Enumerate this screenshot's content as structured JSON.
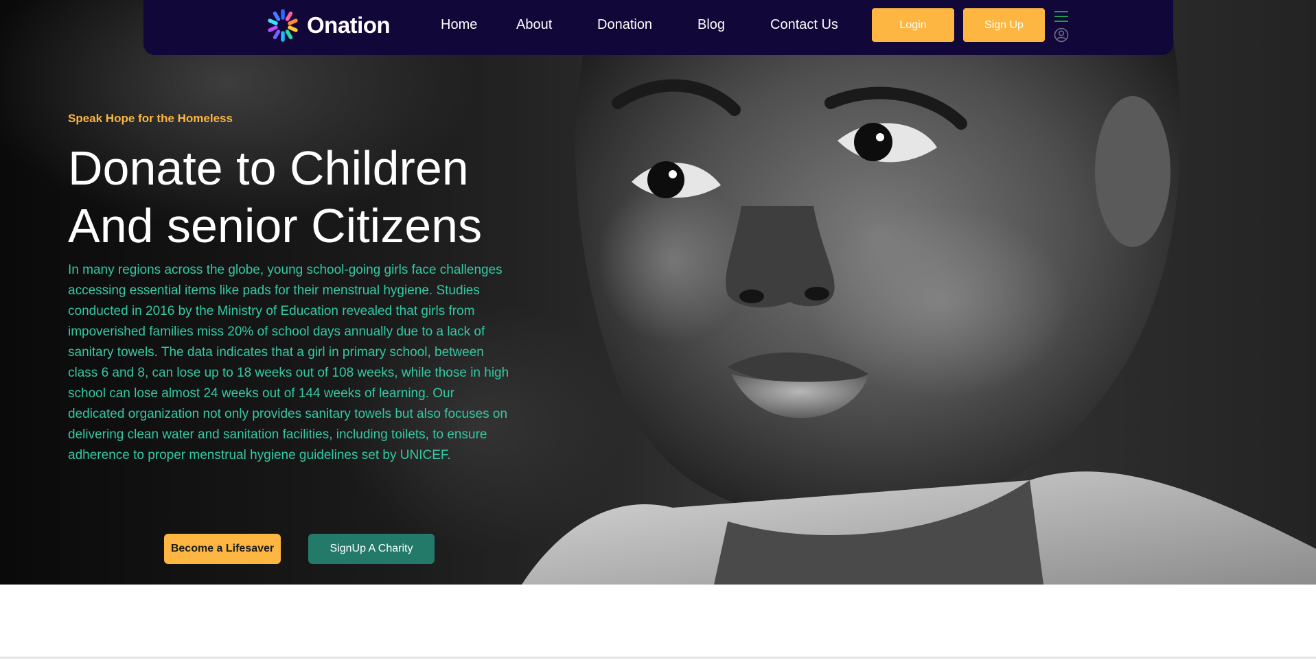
{
  "brand": {
    "name": "Onation"
  },
  "nav": {
    "links": [
      "Home",
      "About",
      "Donation",
      "Blog",
      "Contact Us"
    ],
    "login_label": "Login",
    "signup_label": "Sign Up"
  },
  "hero": {
    "eyebrow": "Speak Hope for the Homeless",
    "headline": [
      "Donate to Children",
      "And senior Citizens"
    ],
    "body": "In many regions across the globe, young school-going girls face challenges accessing essential items like pads for their menstrual hygiene. Studies conducted in 2016 by the Ministry of Education revealed that girls from impoverished families miss 20% of school days annually due to a lack of sanitary towels. The data indicates that a girl in primary school, between class 6 and 8, can lose up to 18 weeks out of 108 weeks, while those in high school can lose almost 24 weeks out of 144 weeks of learning. Our dedicated organization not only provides sanitary towels but also focuses on delivering clean water and sanitation facilities, including toilets, to ensure adherence to proper menstrual hygiene guidelines set by UNICEF.",
    "primary_cta": "Become a Lifesaver",
    "secondary_cta": "SignUp A Charity"
  },
  "colors": {
    "nav_bg": "#110739",
    "accent_yellow": "#fdb642",
    "body_teal": "#34c9a3",
    "charity_green": "#247a69"
  },
  "icons": [
    "onation-logo-icon",
    "menu-icon",
    "user-icon"
  ]
}
